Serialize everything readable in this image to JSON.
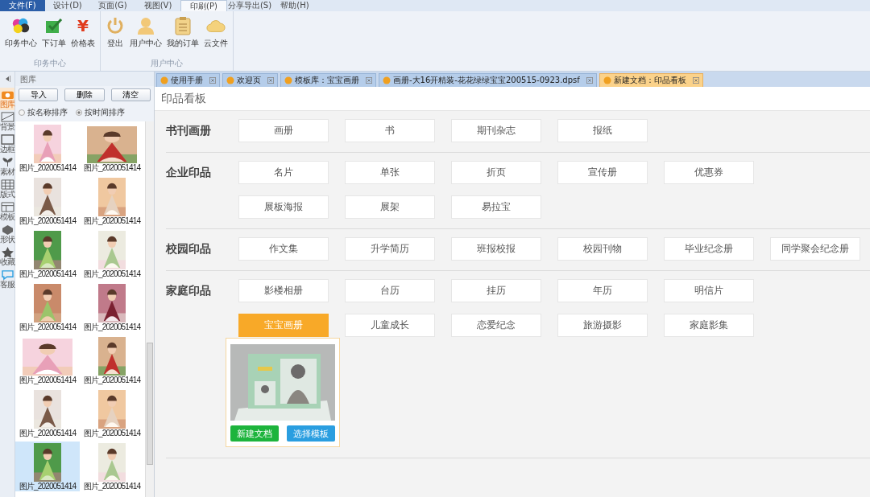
{
  "menu": [
    {
      "label": "文件(F)",
      "kind": "file",
      "selected": false
    },
    {
      "label": "设计(D)",
      "kind": "tab",
      "selected": false
    },
    {
      "label": "页面(G)",
      "kind": "tab",
      "selected": false
    },
    {
      "label": "视图(V)",
      "kind": "tab",
      "selected": false
    },
    {
      "label": "印刷(P)",
      "kind": "tab",
      "selected": true
    },
    {
      "label": "分享导出(S)",
      "kind": "tab",
      "selected": false
    },
    {
      "label": "帮助(H)",
      "kind": "tab",
      "selected": false
    }
  ],
  "ribbon": [
    {
      "label": "印务中心",
      "items": [
        {
          "label": "印务中心"
        },
        {
          "label": "下订单"
        },
        {
          "label": "价格表",
          "glyph": "¥"
        }
      ]
    },
    {
      "label": "用户中心",
      "items": [
        {
          "label": "登出"
        },
        {
          "label": "用户中心"
        },
        {
          "label": "我的订单"
        },
        {
          "label": "云文件"
        }
      ]
    }
  ],
  "tools": [
    {
      "label": "图库",
      "selected": true
    },
    {
      "label": "背景",
      "selected": false
    },
    {
      "label": "边框",
      "selected": false
    },
    {
      "label": "素材",
      "selected": false
    },
    {
      "label": "版式",
      "selected": false
    },
    {
      "label": "模板",
      "selected": false
    },
    {
      "label": "形状",
      "selected": false
    },
    {
      "label": "收藏",
      "selected": false
    },
    {
      "label": "客服",
      "selected": false
    }
  ],
  "library": {
    "title": "图库",
    "buttons": [
      "导入",
      "删除",
      "清空"
    ],
    "sort": [
      {
        "label": "按名称排序",
        "selected": false
      },
      {
        "label": "按时间排序",
        "selected": true
      }
    ],
    "images": [
      {
        "caption": "图片_2020051414",
        "selected": false
      },
      {
        "caption": "图片_2020051414",
        "selected": false
      },
      {
        "caption": "图片_2020051414",
        "selected": false
      },
      {
        "caption": "图片_2020051414",
        "selected": false
      },
      {
        "caption": "图片_2020051414",
        "selected": false
      },
      {
        "caption": "图片_2020051414",
        "selected": false
      },
      {
        "caption": "图片_2020051414",
        "selected": false
      },
      {
        "caption": "图片_2020051414",
        "selected": false
      },
      {
        "caption": "图片_2020051414",
        "selected": false
      },
      {
        "caption": "图片_2020051414",
        "selected": false
      },
      {
        "caption": "图片_2020051414",
        "selected": false
      },
      {
        "caption": "图片_2020051414",
        "selected": false
      },
      {
        "caption": "图片_2020051414",
        "selected": true
      },
      {
        "caption": "图片_2020051414",
        "selected": false
      }
    ]
  },
  "tabs": [
    {
      "label": "使用手册",
      "selected": false
    },
    {
      "label": "欢迎页",
      "selected": false
    },
    {
      "label": "模板库：宝宝画册",
      "selected": false
    },
    {
      "label": "画册-大16开精装-花花绿绿宝宝200515-0923.dpsf",
      "selected": false
    },
    {
      "label": "新建文档：印品看板",
      "selected": true
    }
  ],
  "page_title": "印品看板",
  "sections": [
    {
      "title": "书刊画册",
      "rows": [
        [
          {
            "label": "画册",
            "selected": false
          },
          {
            "label": "书",
            "selected": false
          },
          {
            "label": "期刊杂志",
            "selected": false
          },
          {
            "label": "报纸",
            "selected": false
          }
        ]
      ]
    },
    {
      "title": "企业印品",
      "rows": [
        [
          {
            "label": "名片",
            "selected": false
          },
          {
            "label": "单张",
            "selected": false
          },
          {
            "label": "折页",
            "selected": false
          },
          {
            "label": "宣传册",
            "selected": false
          },
          {
            "label": "优惠券",
            "selected": false
          }
        ],
        [
          {
            "label": "展板海报",
            "selected": false
          },
          {
            "label": "展架",
            "selected": false
          },
          {
            "label": "易拉宝",
            "selected": false
          }
        ]
      ]
    },
    {
      "title": "校园印品",
      "rows": [
        [
          {
            "label": "作文集",
            "selected": false
          },
          {
            "label": "升学简历",
            "selected": false
          },
          {
            "label": "班报校报",
            "selected": false
          },
          {
            "label": "校园刊物",
            "selected": false
          },
          {
            "label": "毕业纪念册",
            "selected": false
          },
          {
            "label": "同学聚会纪念册",
            "selected": false
          }
        ]
      ]
    },
    {
      "title": "家庭印品",
      "rows": [
        [
          {
            "label": "影楼相册",
            "selected": false
          },
          {
            "label": "台历",
            "selected": false
          },
          {
            "label": "挂历",
            "selected": false
          },
          {
            "label": "年历",
            "selected": false
          },
          {
            "label": "明信片",
            "selected": false
          }
        ],
        [
          {
            "label": "宝宝画册",
            "selected": true
          },
          {
            "label": "儿童成长",
            "selected": false
          },
          {
            "label": "恋爱纪念",
            "selected": false
          },
          {
            "label": "旅游摄影",
            "selected": false
          },
          {
            "label": "家庭影集",
            "selected": false
          }
        ]
      ]
    }
  ],
  "popup": {
    "buttons": [
      {
        "label": "新建文档",
        "color": "#1db43c"
      },
      {
        "label": "选择模板",
        "color": "#2a9ee0"
      }
    ]
  }
}
